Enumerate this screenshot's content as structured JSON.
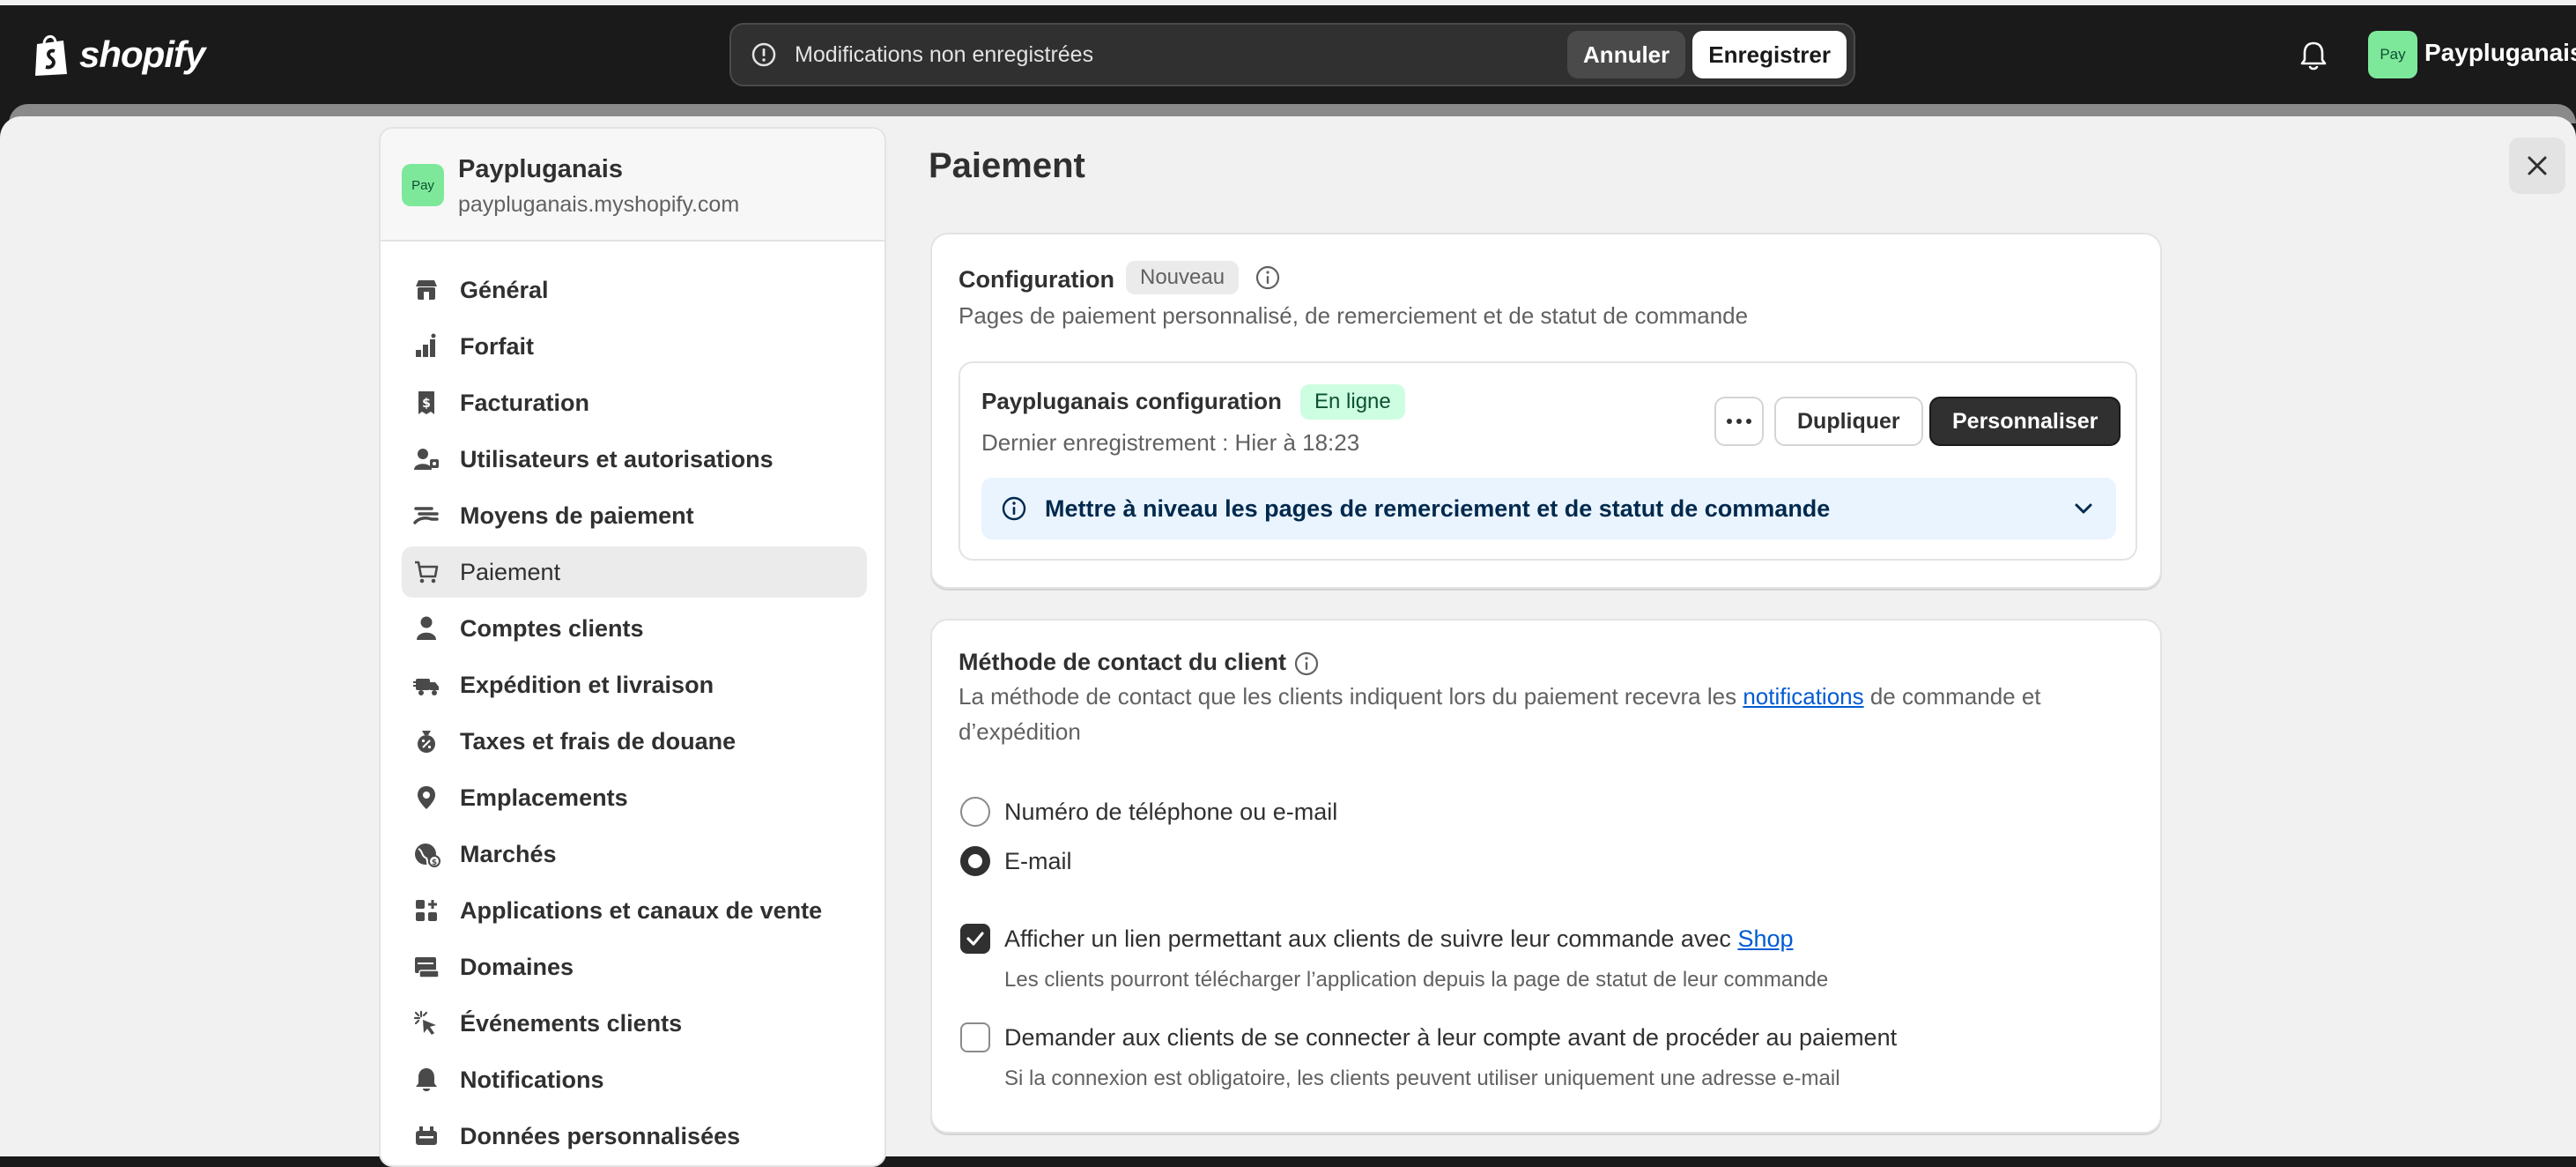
{
  "topbar": {
    "logo_text": "shopify",
    "unsaved_message": "Modifications non enregistrées",
    "cancel_label": "Annuler",
    "save_label": "Enregistrer",
    "store_avatar": "Pay",
    "store_name": "Paypluganais"
  },
  "sidebar": {
    "avatar": "Pay",
    "store_name": "Paypluganais",
    "store_url": "paypluganais.myshopify.com",
    "items": [
      {
        "label": "Général",
        "icon": "store-icon"
      },
      {
        "label": "Forfait",
        "icon": "plan-icon"
      },
      {
        "label": "Facturation",
        "icon": "receipt-icon"
      },
      {
        "label": "Utilisateurs et autorisations",
        "icon": "users-icon"
      },
      {
        "label": "Moyens de paiement",
        "icon": "payment-hand-icon"
      },
      {
        "label": "Paiement",
        "icon": "cart-icon",
        "active": true
      },
      {
        "label": "Comptes clients",
        "icon": "person-icon"
      },
      {
        "label": "Expédition et livraison",
        "icon": "truck-icon"
      },
      {
        "label": "Taxes et frais de douane",
        "icon": "tax-bag-icon"
      },
      {
        "label": "Emplacements",
        "icon": "location-pin-icon"
      },
      {
        "label": "Marchés",
        "icon": "globe-icon"
      },
      {
        "label": "Applications et canaux de vente",
        "icon": "apps-icon"
      },
      {
        "label": "Domaines",
        "icon": "domain-icon"
      },
      {
        "label": "Événements clients",
        "icon": "cursor-click-icon"
      },
      {
        "label": "Notifications",
        "icon": "bell-icon"
      },
      {
        "label": "Données personnalisées",
        "icon": "database-icon"
      }
    ]
  },
  "main": {
    "page_title": "Paiement",
    "config_card": {
      "title": "Configuration",
      "badge": "Nouveau",
      "description": "Pages de paiement personnalisé, de remerciement et de statut de commande",
      "config_name": "Paypluganais configuration",
      "status_badge": "En ligne",
      "last_saved": "Dernier enregistrement : Hier à 18:23",
      "duplicate_label": "Dupliquer",
      "customize_label": "Personnaliser",
      "banner_text": "Mettre à niveau les pages de remerciement et de statut de commande"
    },
    "contact_card": {
      "title": "Méthode de contact du client",
      "desc_before": "La méthode de contact que les clients indiquent lors du paiement recevra les ",
      "desc_link": "notifications",
      "desc_after": " de commande et",
      "desc_line2": "d’expédition",
      "radio_phone_or_email": "Numéro de téléphone ou e-mail",
      "radio_email": "E-mail",
      "selected_radio": "E-mail",
      "check_shop_before": "Afficher un lien permettant aux clients de suivre leur commande avec ",
      "check_shop_link": "Shop",
      "check_shop_checked": true,
      "check_shop_help": "Les clients pourront télécharger l’application depuis la page de statut de leur commande",
      "check_login": "Demander aux clients de se connecter à leur compte avant de procéder au paiement",
      "check_login_checked": false,
      "check_login_help": "Si la connexion est obligatoire, les clients peuvent utiliser uniquement une adresse e-mail"
    }
  }
}
